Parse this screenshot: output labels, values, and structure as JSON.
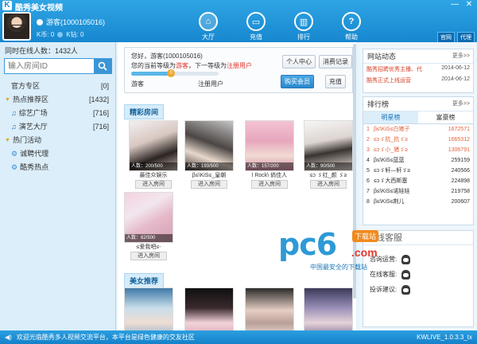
{
  "app": {
    "title": "酷秀美女视频"
  },
  "window": {
    "min": "—",
    "close": "✕"
  },
  "user": {
    "name": "游客(1000105016)",
    "coins": "K币: 0",
    "stones": "K钻: 0"
  },
  "nav": [
    {
      "label": "大厅",
      "glyph": "⌂"
    },
    {
      "label": "充值",
      "glyph": "▭"
    },
    {
      "label": "排行",
      "glyph": "▥"
    },
    {
      "label": "帮助",
      "glyph": "?"
    }
  ],
  "top_links": [
    "官网",
    "代理"
  ],
  "sidebar": {
    "online": "同时在线人数：1432人",
    "search_placeholder": "输入房间ID",
    "items": [
      {
        "label": "官方专区",
        "count": "[0]"
      },
      {
        "label": "热点推荐区",
        "count": "[1432]"
      },
      {
        "label": "综艺广场",
        "count": "[716]"
      },
      {
        "label": "演艺大厅",
        "count": "[716]"
      },
      {
        "label": "热门活动",
        "count": ""
      },
      {
        "label": "诚聘代理",
        "count": ""
      },
      {
        "label": "酷秀热点",
        "count": ""
      }
    ]
  },
  "user_card": {
    "hello": "您好，游客(1000105016)",
    "level_text_a": "您的当前等级为",
    "level_current": "游客",
    "level_text_b": "，下一等级为",
    "level_next": "注册用户",
    "lvl_a": "游客",
    "lvl_b": "注册用户",
    "progress_level": "0",
    "btn_profile": "个人中心",
    "btn_records": "消费记录",
    "btn_vip": "购买会员",
    "btn_recharge": "充值"
  },
  "sections": {
    "rooms_title": "精彩房间",
    "beauty_title": "美女推荐"
  },
  "rooms": [
    {
      "people": "人数：200/500",
      "name": "最佳众娱乐",
      "enter": "进入房间"
    },
    {
      "people": "人数：193/500",
      "name": "β≤\\KiS≤_皇朝",
      "enter": "进入房间"
    },
    {
      "people": "人数：157/200",
      "name": "l Rock\\ 倘佳人",
      "enter": "进入房间"
    },
    {
      "people": "人数：90/500",
      "name": "≤ɔ ゞ红_颜 ゞ≥",
      "enter": "进入房间"
    },
    {
      "people": "人数：82/500",
      "name": "≤爱我吧≤-",
      "enter": "进入房间"
    }
  ],
  "news": {
    "title": "网站动态",
    "more": "更多>>",
    "items": [
      {
        "text": "酷秀招聘优秀主播、代",
        "date": "2014-06-12"
      },
      {
        "text": "酷秀正式上线运营",
        "date": "2014-06-12"
      }
    ]
  },
  "ranking": {
    "title": "排行榜",
    "more": "更多>>",
    "tabs": [
      "明星榜",
      "富豪榜"
    ],
    "rows": [
      {
        "n": "1",
        "name": "β≤\\KiS≤白猪子",
        "val": "1672571"
      },
      {
        "n": "2",
        "name": "≤ɔゞ抗_抗ゞ≥",
        "val": "1665312"
      },
      {
        "n": "3",
        "name": "≤ɔゞ小_猪ゞ≥",
        "val": "1306791"
      },
      {
        "n": "4",
        "name": "β≤\\KiS≤蓝蓝",
        "val": "259159"
      },
      {
        "n": "5",
        "name": "≤ɔゞ轩—轩ゞ≥",
        "val": "240566"
      },
      {
        "n": "6",
        "name": "≤ɔゞ大西斯塞",
        "val": "224898"
      },
      {
        "n": "7",
        "name": "β≤\\KiS≤诺娃娃",
        "val": "219758"
      },
      {
        "n": "8",
        "name": "β≤\\KiS≤荆儿",
        "val": "200607"
      }
    ]
  },
  "service": {
    "title": "在线客服",
    "rows": [
      "咨询运营:",
      "在线客服:",
      "投诉建议:"
    ]
  },
  "watermark": {
    "brand": "pc6",
    "badge": "下载站",
    "com": ".com",
    "sub": "中国最安全的下载站"
  },
  "status": {
    "notice": "欢迎光临酷秀多人视频交流平台，本平台是绿色健康的交友社区",
    "version": "KWLIVE_1.0.3.3_tx"
  }
}
